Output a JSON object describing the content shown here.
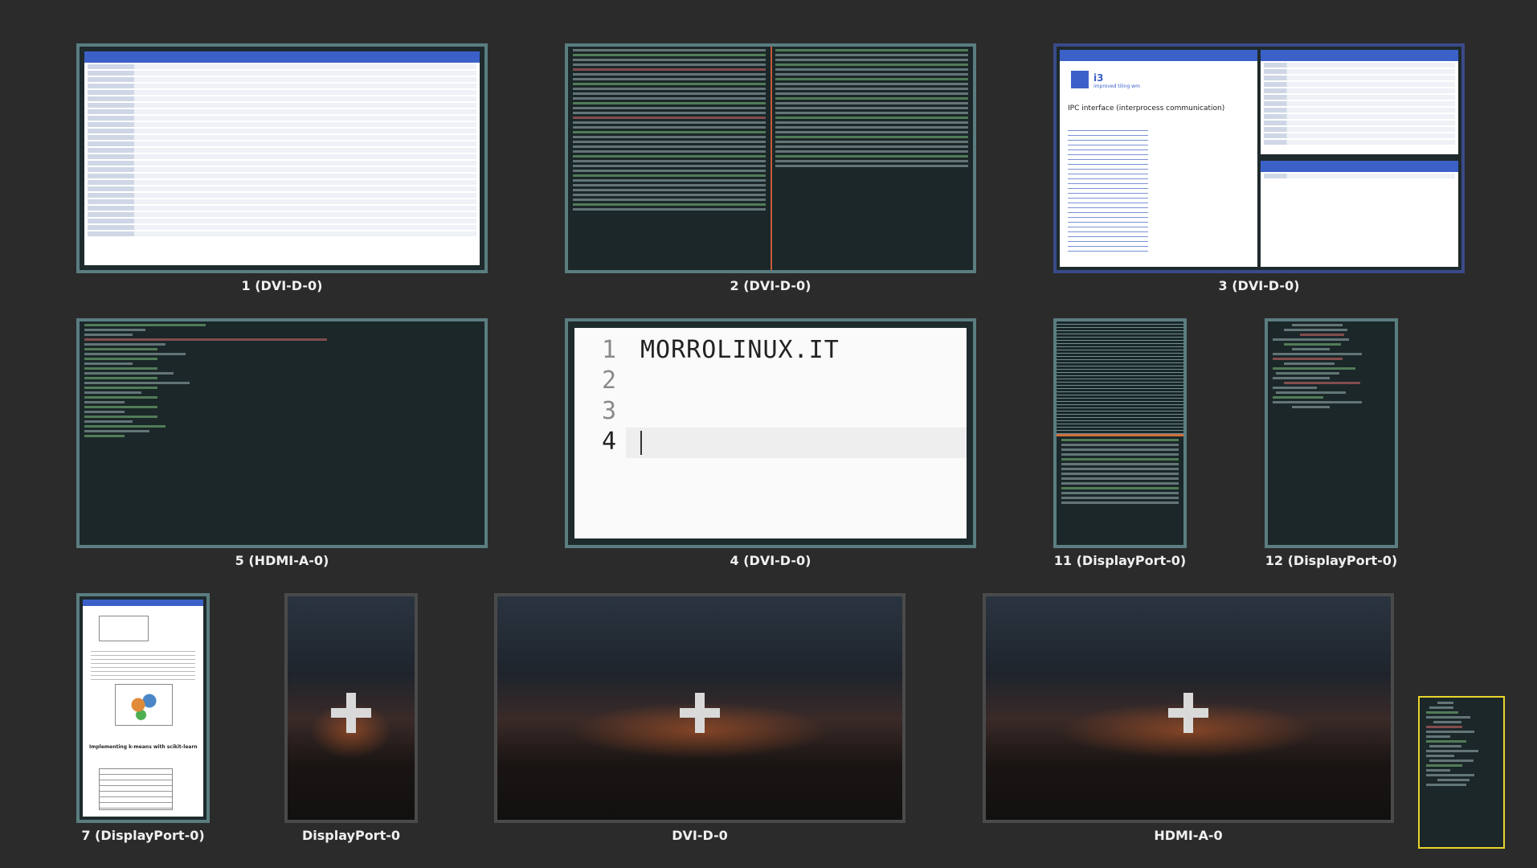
{
  "workspaces": [
    {
      "id": "ws1",
      "label": "1 (DVI-D-0)",
      "kind": "file-manager"
    },
    {
      "id": "ws2",
      "label": "2 (DVI-D-0)",
      "kind": "terminal"
    },
    {
      "id": "ws3",
      "label": "3 (DVI-D-0)",
      "kind": "browser",
      "page_title": "IPC interface (interprocess communication)",
      "site": "i3",
      "site_sub": "improved tiling wm"
    },
    {
      "id": "ws5",
      "label": "5 (HDMI-A-0)",
      "kind": "terminal"
    },
    {
      "id": "ws4",
      "label": "4 (DVI-D-0)",
      "kind": "editor",
      "editor_text": "MORROLINUX.IT",
      "line_numbers": [
        "1",
        "2",
        "3",
        "4"
      ]
    },
    {
      "id": "ws11",
      "label": "11 (DisplayPort-0)",
      "kind": "terminal"
    },
    {
      "id": "ws12",
      "label": "12 (DisplayPort-0)",
      "kind": "terminal"
    },
    {
      "id": "ws7",
      "label": "7 (DisplayPort-0)",
      "kind": "document",
      "doc_heading": "Implementing k-means with scikit-learn"
    },
    {
      "id": "new-dp0",
      "label": "DisplayPort-0",
      "kind": "new"
    },
    {
      "id": "new-dvi0",
      "label": "DVI-D-0",
      "kind": "new"
    },
    {
      "id": "new-hdmi0",
      "label": "HDMI-A-0",
      "kind": "new"
    }
  ],
  "colors": {
    "background": "#2b2b2b",
    "thumb_border": "#5a7d80",
    "selected_border": "#e9d52b",
    "label": "#f0f0f0"
  }
}
